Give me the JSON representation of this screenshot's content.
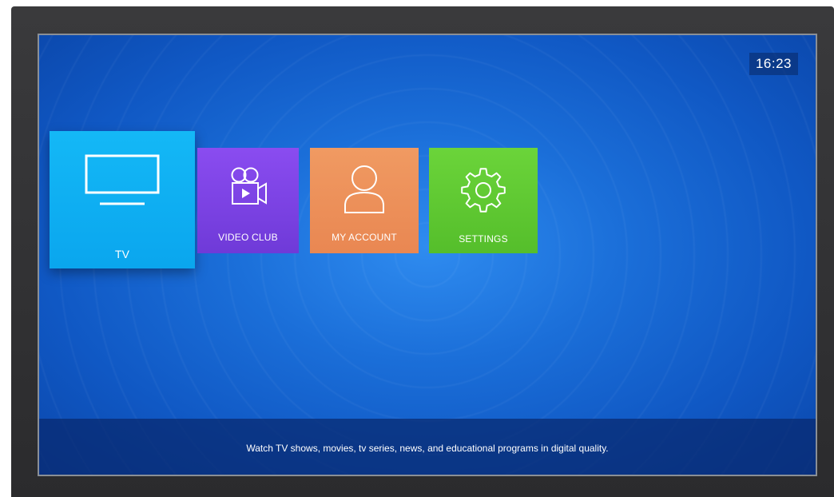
{
  "status": {
    "time": "16:23"
  },
  "menu": {
    "tiles": [
      {
        "label": "TV",
        "icon": "tv-monitor-icon",
        "color": "#0aa6ee",
        "selected": true
      },
      {
        "label": "VIDEO CLUB",
        "icon": "video-camera-icon",
        "color": "#7a40e2",
        "selected": false
      },
      {
        "label": "MY ACCOUNT",
        "icon": "user-icon",
        "color": "#ec8f58",
        "selected": false
      },
      {
        "label": "SETTINGS",
        "icon": "gear-icon",
        "color": "#5fc832",
        "selected": false
      }
    ]
  },
  "footer": {
    "description": "Watch TV shows, movies, tv series, news, and educational programs in digital quality."
  },
  "colors": {
    "background": "#1b6fd9",
    "bezel": "#2f2f31"
  }
}
